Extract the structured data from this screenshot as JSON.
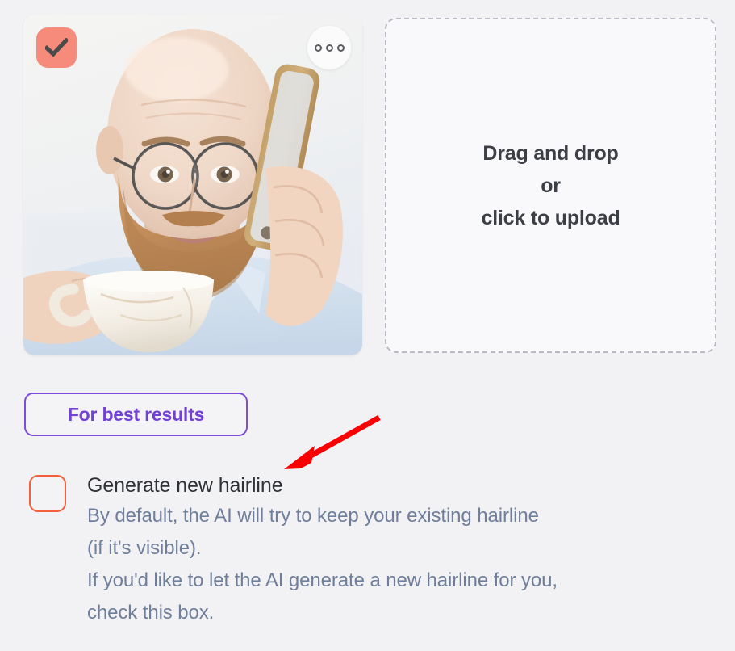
{
  "page": {
    "background_color": "#f2f2f4"
  },
  "photo_card": {
    "name": "uploaded-photo",
    "alt": "Bald bearded man with round glasses talking on a phone while holding a coffee cup",
    "selected": true,
    "badge": {
      "icon": "check-icon",
      "background_color": "#f68b7c",
      "check_color": "#4a4a4a"
    },
    "menu": {
      "icon": "more-options-icon",
      "dot_count": 3,
      "dot_color": "#5b5d61"
    }
  },
  "dropzone": {
    "line1": "Drag and drop",
    "line2": "or",
    "line3": "click to upload",
    "border_color": "#b9bbc4",
    "background_color": "#f9f8fb",
    "text_color": "#3c3f45"
  },
  "best_results": {
    "label": "For best results",
    "border_color": "#7b4ddd",
    "text_color": "#7240d6"
  },
  "annotation": {
    "type": "arrow",
    "color": "#fb0000",
    "points_to": "generate-new-hairline-option"
  },
  "option": {
    "checkbox": {
      "checked": false,
      "border_color": "#f4603e"
    },
    "title": "Generate new hairline",
    "title_color": "#2e3136",
    "description_lines": [
      "By default, the AI will try to keep your existing hairline",
      "(if it's visible).",
      "If you'd like to let the AI generate a new hairline for you,",
      "check this box."
    ],
    "description_color": "#6f7f9b"
  }
}
